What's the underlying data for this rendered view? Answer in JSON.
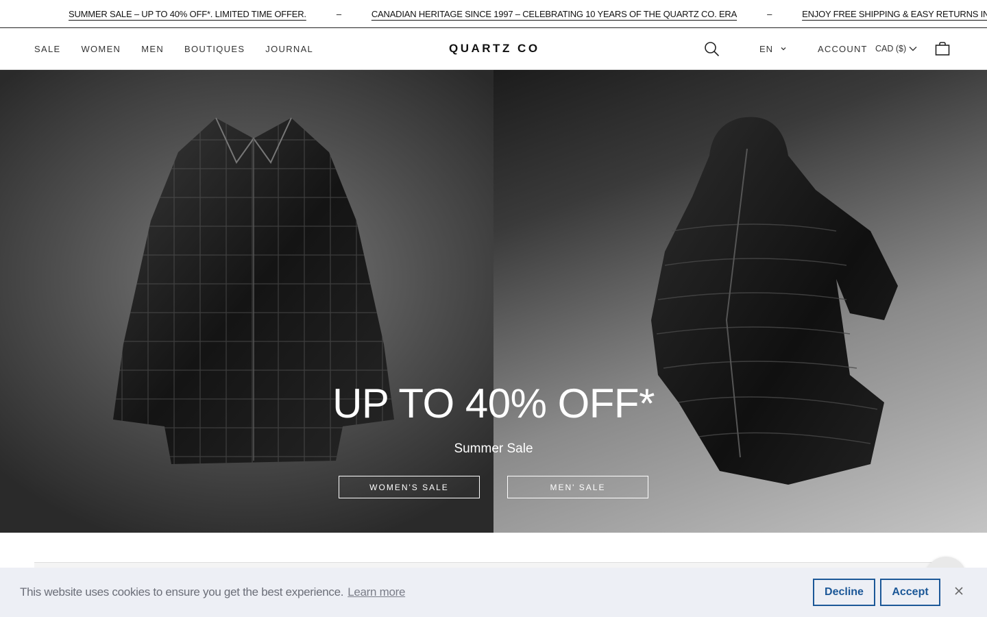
{
  "announcement": {
    "items": [
      "SUMMER SALE – UP TO 40% OFF*. LIMITED TIME OFFER.",
      "CANADIAN HERITAGE SINCE 1997 – CELEBRATING 10 YEARS OF THE QUARTZ CO. ERA",
      "ENJOY FREE SHIPPING & EASY RETURNS IN CANADA"
    ],
    "separator": "–"
  },
  "header": {
    "nav": [
      "SALE",
      "WOMEN",
      "MEN",
      "BOUTIQUES",
      "JOURNAL"
    ],
    "logo": "QUARTZ CO",
    "language": "EN",
    "account": "ACCOUNT",
    "currency": "CAD ($)",
    "icons": {
      "search": "search-icon",
      "cart": "shopping-bag-icon",
      "chevron": "chevron-down-icon"
    }
  },
  "hero": {
    "title": "UP TO 40% OFF*",
    "subtitle": "Summer Sale",
    "buttons": {
      "women": "WOMEN'S SALE",
      "men": "MEN' SALE"
    }
  },
  "cookie": {
    "message": "This website uses cookies to ensure you get the best experience.",
    "learn_more": "Learn more",
    "decline": "Decline",
    "accept": "Accept",
    "accent_color": "#1b5797"
  }
}
